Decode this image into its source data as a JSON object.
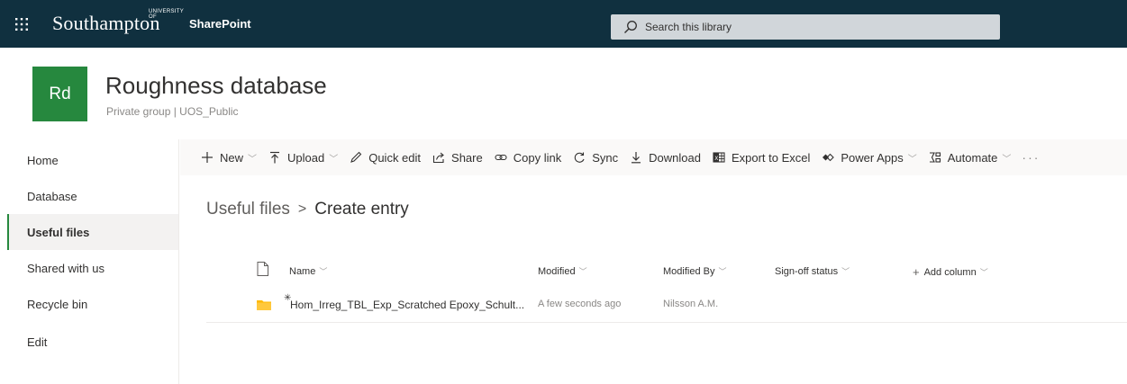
{
  "suite": {
    "brand_prefix": "UNIVERSITY OF",
    "brand_name": "Southampton",
    "app_name": "SharePoint",
    "search_placeholder": "Search this library",
    "waffle_icon": "app-launcher-icon",
    "search_icon": "search-icon",
    "header_color": "#10303f"
  },
  "site": {
    "logo_text": "Rd",
    "logo_color": "#26883e",
    "title": "Roughness database",
    "subtitle": "Private group | UOS_Public"
  },
  "nav": {
    "items": [
      {
        "label": "Home",
        "active": false
      },
      {
        "label": "Database",
        "active": false
      },
      {
        "label": "Useful files",
        "active": true
      },
      {
        "label": "Shared with us",
        "active": false
      },
      {
        "label": "Recycle bin",
        "active": false
      },
      {
        "label": "Edit",
        "active": false
      }
    ]
  },
  "commands": {
    "new": "New",
    "upload": "Upload",
    "quick_edit": "Quick edit",
    "share": "Share",
    "copy_link": "Copy link",
    "sync": "Sync",
    "download": "Download",
    "export_excel": "Export to Excel",
    "power_apps": "Power Apps",
    "automate": "Automate",
    "more": "···"
  },
  "breadcrumb": {
    "parent": "Useful files",
    "separator": ">",
    "current": "Create entry"
  },
  "list": {
    "columns": {
      "name": "Name",
      "modified": "Modified",
      "modified_by": "Modified By",
      "signoff": "Sign-off status",
      "add_column": "Add column"
    },
    "rows": [
      {
        "name": "Hom_Irreg_TBL_Exp_Scratched Epoxy_Schult...",
        "modified": "A few seconds ago",
        "modified_by": "Nilsson A.M.",
        "type_icon": "folder-icon",
        "folder_color": "#ffb900"
      }
    ]
  }
}
